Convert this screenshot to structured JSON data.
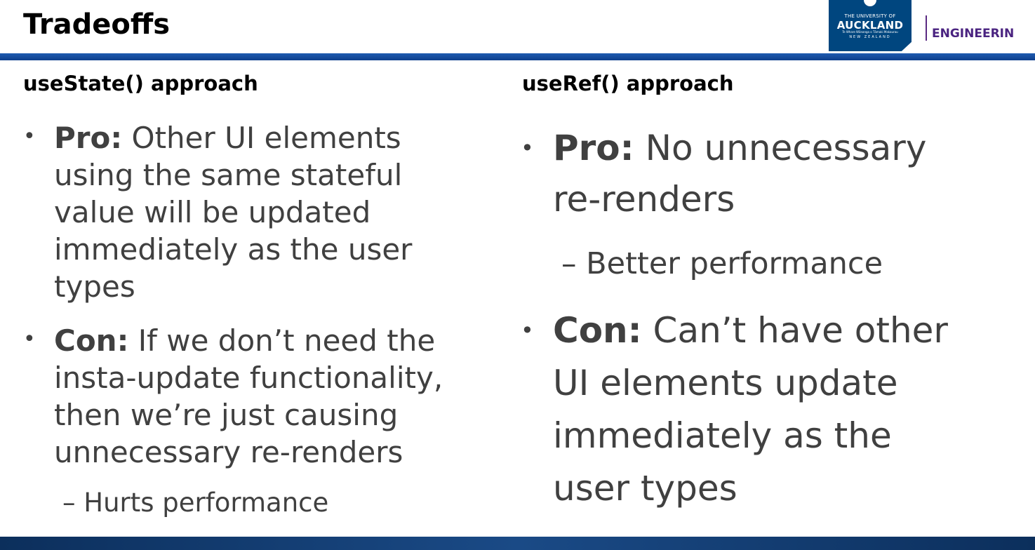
{
  "slide": {
    "title": "Tradeoffs"
  },
  "branding": {
    "logo_line1": "THE UNIVERSITY OF",
    "logo_line2": "AUCKLAND",
    "logo_line3": "Te Whare Wānanga o Tāmaki Makaurau",
    "logo_line4": "NEW ZEALAND",
    "faculty": "ENGINEERIN",
    "colors": {
      "logo_bg": "#00467f",
      "faculty_text": "#4a2380",
      "header_rule": "#1f5bb0"
    }
  },
  "left": {
    "heading": "useState() approach",
    "pro_label": "Pro:",
    "pro_text": "Other UI elements using the same stateful value will be updated immediately as the user types",
    "con_label": "Con:",
    "con_text": "If we don’t need the insta-update functionality, then we’re just causing unnecessary re-renders",
    "con_sub": "– Hurts performance"
  },
  "right": {
    "heading": "useRef() approach",
    "pro_label": "Pro:",
    "pro_text": "No unnecessary re-renders",
    "pro_sub": "– Better performance",
    "con_label": "Con:",
    "con_text": "Can’t have other UI elements update immediately as the user types"
  },
  "bullet_glyph": "•"
}
